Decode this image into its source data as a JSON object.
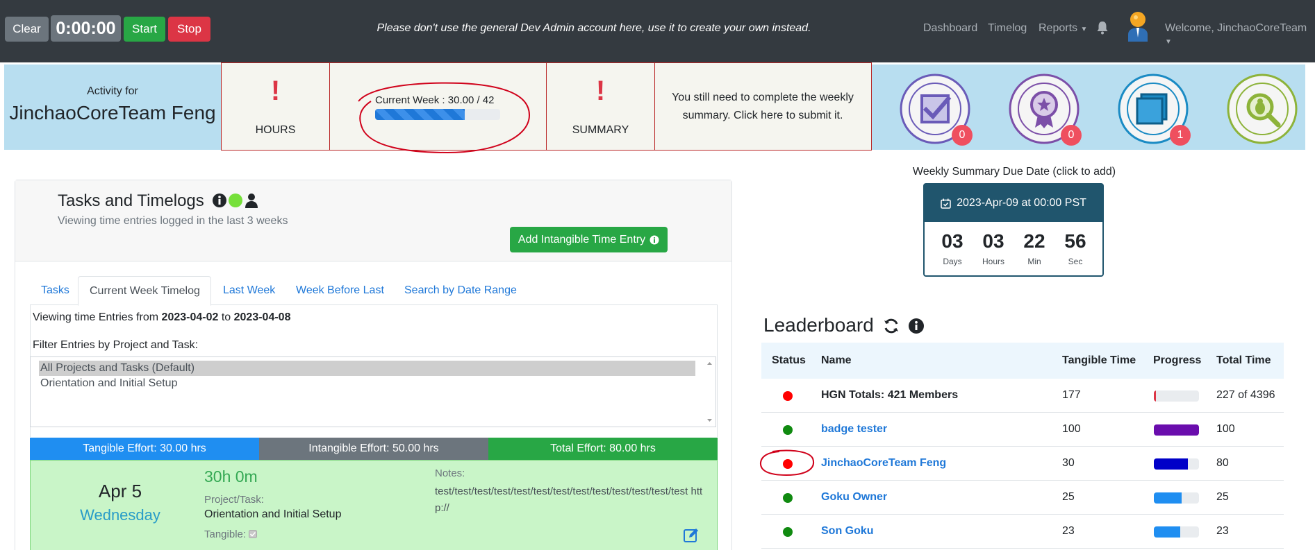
{
  "toolbar": {
    "clear_label": "Clear",
    "timer": "0:00:00",
    "start_label": "Start",
    "stop_label": "Stop"
  },
  "notice": "Please don't use the general Dev Admin account here, use it to create your own instead.",
  "nav": {
    "dashboard": "Dashboard",
    "timelog": "Timelog",
    "reports": "Reports",
    "welcome": "Welcome, JinchaoCoreTeam"
  },
  "summary_strip": {
    "activity_for": "Activity for",
    "user_name": "JinchaoCoreTeam Feng",
    "hours_label": "HOURS",
    "current_week_text": "Current Week : 30.00 / 42",
    "current_week_progress": 0.714,
    "summary_label": "SUMMARY",
    "summary_message": "You still need to complete the weekly summary. Click here to submit it.",
    "badges": [
      {
        "name": "tasks-badge-icon",
        "count": "0",
        "color": "#6a5bb8"
      },
      {
        "name": "badges-badge-icon",
        "count": "0",
        "color": "#7c4fa8"
      },
      {
        "name": "blue-square-badge-icon",
        "count": "1",
        "color": "#1b8bc4"
      },
      {
        "name": "report-bug-badge-icon",
        "count": "",
        "color": "#8db33a"
      }
    ]
  },
  "tasks_panel": {
    "title": "Tasks and Timelogs",
    "subtitle": "Viewing time entries logged in the last 3 weeks",
    "add_intangible_label": "Add Intangible Time Entry",
    "tabs": [
      "Tasks",
      "Current Week Timelog",
      "Last Week",
      "Week Before Last",
      "Search by Date Range"
    ],
    "viewing_prefix": "Viewing time Entries from ",
    "from_date": "2023-04-02",
    "to_word": " to ",
    "to_date": "2023-04-08",
    "filter_label": "Filter Entries by Project and Task:",
    "filter_options": [
      "All Projects and Tasks (Default)",
      "Orientation and Initial Setup"
    ],
    "tangible_effort": "Tangible Effort: 30.00 hrs",
    "intangible_effort": "Intangible Effort: 50.00 hrs",
    "total_effort": "Total Effort: 80.00 hrs",
    "entry": {
      "date": "Apr 5",
      "weekday": "Wednesday",
      "time": "30h 0m",
      "project_label": "Project/Task:",
      "project": "Orientation and Initial Setup",
      "tangible_label": "Tangible:",
      "notes_label": "Notes:",
      "notes": "test/test/test/test/test/test/test/test/test/test/test/test/test http://"
    }
  },
  "weekly_summary": {
    "due_label": "Weekly Summary Due Date (click to add)",
    "due_date": "2023-Apr-09 at 00:00 PST",
    "countdown": [
      {
        "value": "03",
        "unit": "Days"
      },
      {
        "value": "03",
        "unit": "Hours"
      },
      {
        "value": "22",
        "unit": "Min"
      },
      {
        "value": "56",
        "unit": "Sec"
      }
    ]
  },
  "leaderboard": {
    "title": "Leaderboard",
    "columns": [
      "Status",
      "Name",
      "Tangible Time",
      "Progress",
      "Total Time"
    ],
    "rows": [
      {
        "status": "red",
        "name": "HGN Totals: 421 Members",
        "tangible": "177",
        "progress": 0.04,
        "bar_color": "#dc3545",
        "total": "227 of 4396",
        "link": false
      },
      {
        "status": "green",
        "name": "badge tester",
        "tangible": "100",
        "progress": 1.0,
        "bar_color": "#6a0dad",
        "total": "100",
        "link": true
      },
      {
        "status": "red",
        "name": "JinchaoCoreTeam Feng",
        "tangible": "30",
        "progress": 0.75,
        "bar_color": "#0000c8",
        "total": "80",
        "link": true
      },
      {
        "status": "green",
        "name": "Goku Owner",
        "tangible": "25",
        "progress": 0.62,
        "bar_color": "#1f8ef1",
        "total": "25",
        "link": true
      },
      {
        "status": "green",
        "name": "Son Goku",
        "tangible": "23",
        "progress": 0.58,
        "bar_color": "#1f8ef1",
        "total": "23",
        "link": true
      }
    ]
  },
  "colors": {
    "navbar": "#343a40",
    "strip": "#b8def0",
    "link": "#1f78d8",
    "green": "#28a745",
    "red": "#dc3545",
    "annotation": "#d0021b"
  }
}
